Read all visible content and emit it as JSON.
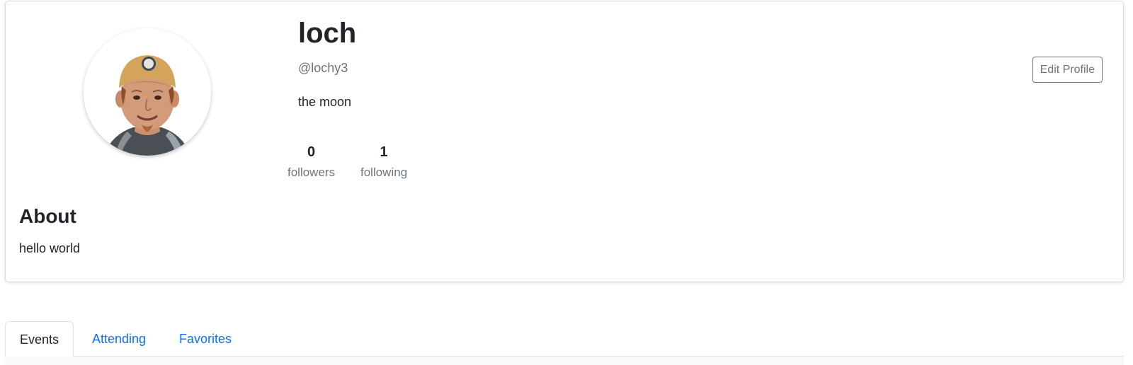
{
  "profile": {
    "display_name": "loch",
    "username": "@lochy3",
    "bio": "the moon",
    "stats": [
      {
        "count": "0",
        "label": "followers"
      },
      {
        "count": "1",
        "label": "following"
      }
    ],
    "edit_label": "Edit Profile",
    "avatar_icon": "user-avatar-photo"
  },
  "about": {
    "heading": "About",
    "text": "hello world"
  },
  "tabs": [
    {
      "label": "Events",
      "active": true
    },
    {
      "label": "Attending",
      "active": false
    },
    {
      "label": "Favorites",
      "active": false
    }
  ],
  "colors": {
    "link": "#0d6efd",
    "muted": "#6c757d",
    "text": "#212529",
    "border": "#dee2e6"
  }
}
